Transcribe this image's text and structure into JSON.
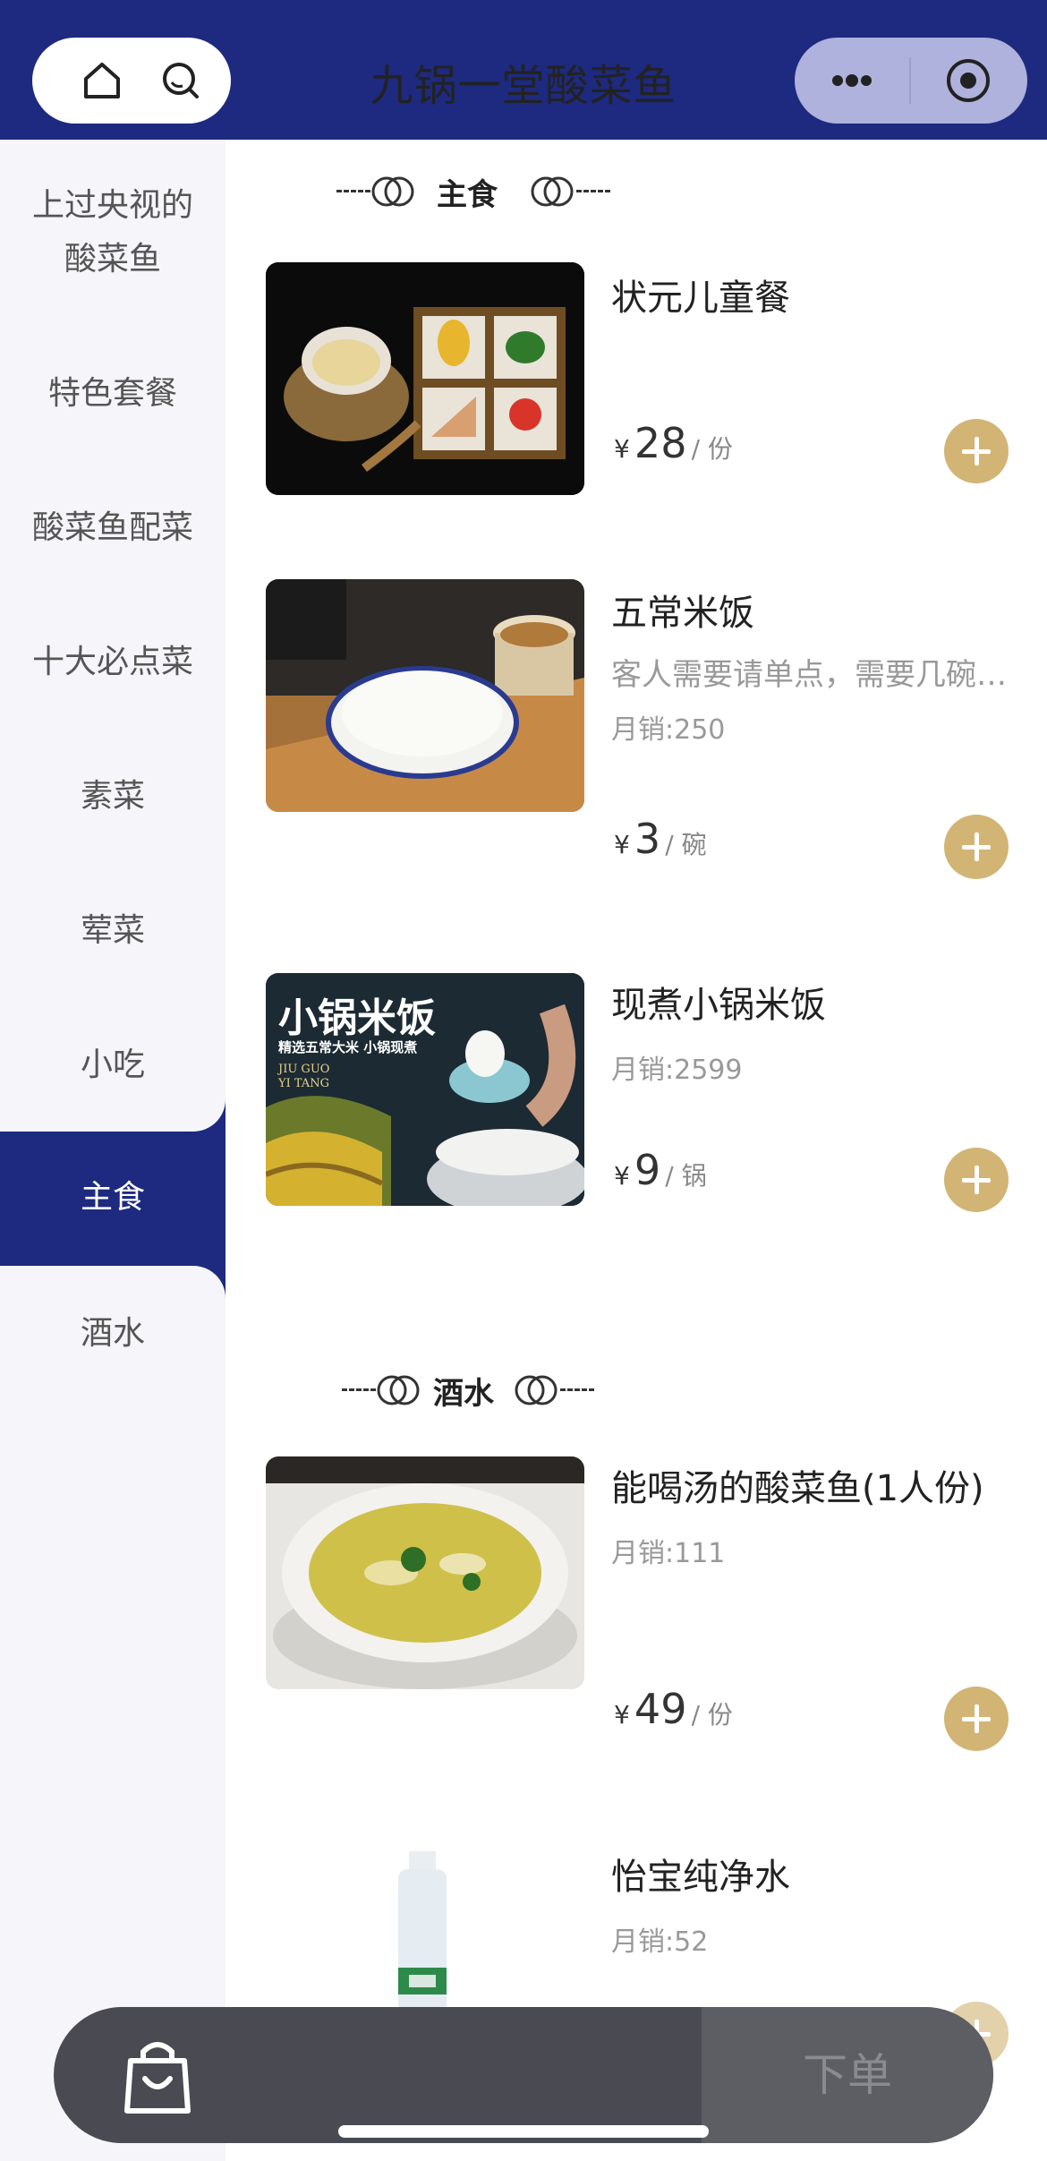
{
  "header": {
    "title": "九锅一堂酸菜鱼",
    "left_icons": [
      "home-icon",
      "search-icon"
    ],
    "right_icons": [
      "more-icon",
      "record-icon"
    ],
    "bg_color": "#1d2a80"
  },
  "sidebar": {
    "items": [
      {
        "label": "上过央视的\n酸菜鱼",
        "active": false
      },
      {
        "label": "特色套餐",
        "active": false
      },
      {
        "label": "酸菜鱼配菜",
        "active": false
      },
      {
        "label": "十大必点菜",
        "active": false
      },
      {
        "label": "素菜",
        "active": false
      },
      {
        "label": "荤菜",
        "active": false
      },
      {
        "label": "小吃",
        "active": false
      },
      {
        "label": "主食",
        "active": true
      },
      {
        "label": "酒水",
        "active": false
      }
    ]
  },
  "sections": [
    {
      "title": "主食",
      "products": [
        {
          "name": "状元儿童餐",
          "price_currency": "¥",
          "price": "28",
          "unit": "/ 份"
        },
        {
          "name": "五常米饭",
          "desc": "客人需要请单点，需要几碗…",
          "sales": "月销:250",
          "price_currency": "¥",
          "price": "3",
          "unit": "/ 碗"
        },
        {
          "name": "现煮小锅米饭",
          "sales": "月销:2599",
          "price_currency": "¥",
          "price": "9",
          "unit": "/ 锅",
          "image_text": {
            "title": "小锅米饭",
            "subtitle": "精选五常大米 小锅现煮",
            "brand1": "JIU GUO",
            "brand2": "YI TANG"
          }
        }
      ]
    },
    {
      "title": "酒水",
      "products": [
        {
          "name": "能喝汤的酸菜鱼(1人份)",
          "sales": "月销:111",
          "price_currency": "¥",
          "price": "49",
          "unit": "/ 份"
        },
        {
          "name": "怡宝纯净水",
          "sales": "月销:52"
        }
      ]
    }
  ],
  "cart": {
    "order_label": "下单",
    "cart_icon": "shopping-bag-icon"
  },
  "colors": {
    "accent": "#d2b475",
    "nav": "#1d2a80"
  }
}
